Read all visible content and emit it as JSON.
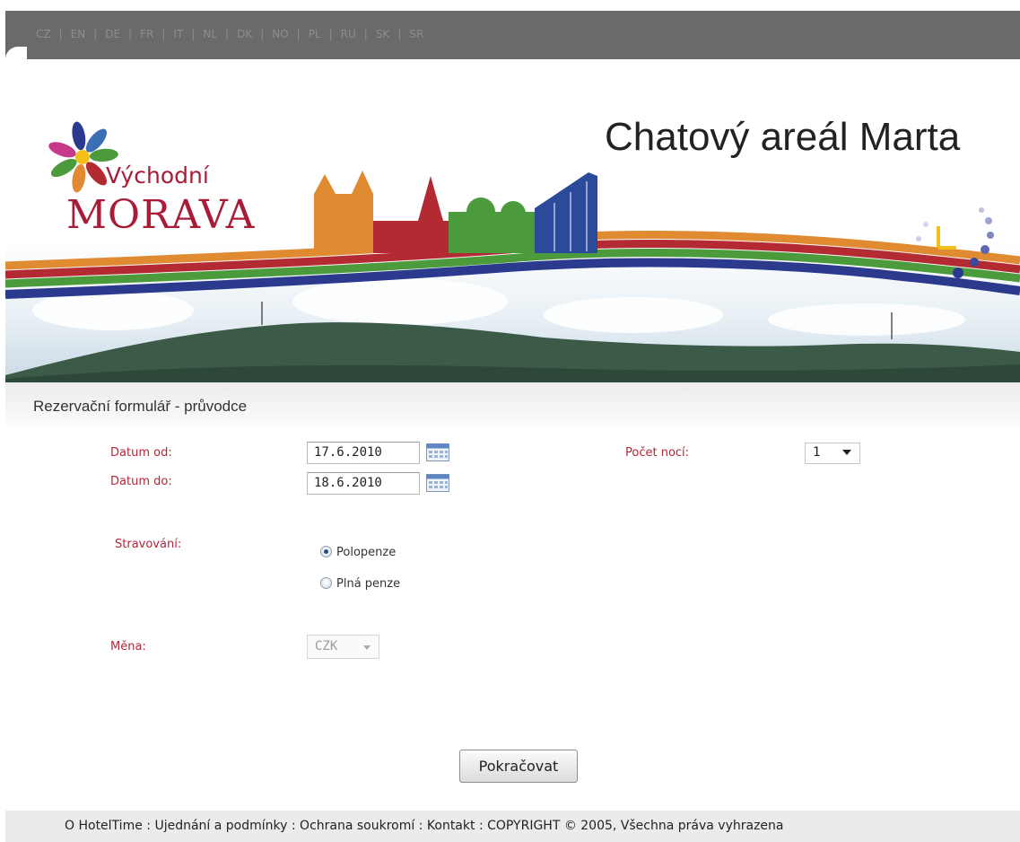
{
  "languages": [
    "CZ",
    "EN",
    "DE",
    "FR",
    "IT",
    "NL",
    "DK",
    "NO",
    "PL",
    "RU",
    "SK",
    "SR"
  ],
  "logo": {
    "line1": "Východní",
    "line2": "MORAVA"
  },
  "site_title": "Chatový areál Marta",
  "section_title": "Rezervační formulář - průvodce",
  "form": {
    "date_from_label": "Datum od:",
    "date_from_value": "17.6.2010",
    "date_to_label": "Datum do:",
    "date_to_value": "18.6.2010",
    "nights_label": "Počet nocí:",
    "nights_value": "1",
    "board_label": "Stravování:",
    "board_options": [
      "Polopenze",
      "Plná penze"
    ],
    "board_selected": "Polopenze",
    "currency_label": "Měna:",
    "currency_value": "CZK",
    "continue_button": "Pokračovat"
  },
  "footer": {
    "links": [
      "O HotelTime",
      "Ujednání a podmínky",
      "Ochrana soukromí",
      "Kontakt"
    ],
    "copyright": "COPYRIGHT © 2005, Všechna práva vyhrazena"
  },
  "colors": {
    "label_red": "#b0263a",
    "langbar": "#6a6a6a",
    "sky": "#dfe9f0"
  }
}
